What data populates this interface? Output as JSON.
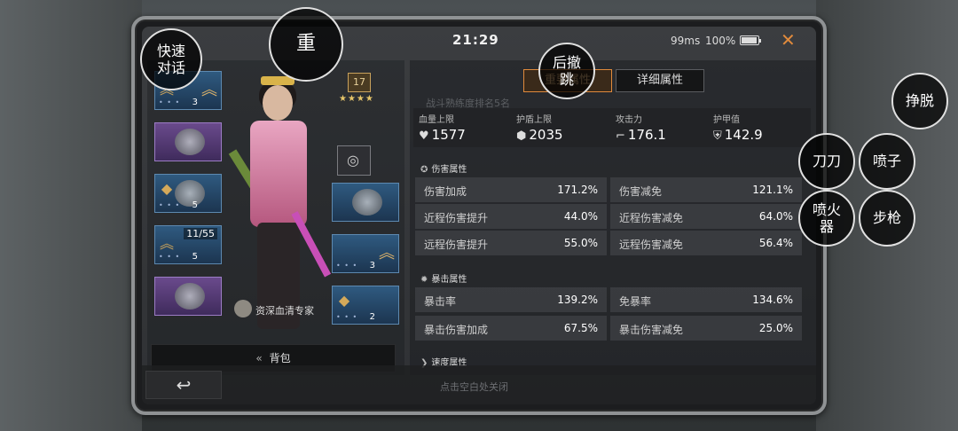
{
  "status": {
    "time": "21:29",
    "ping": "99ms",
    "battery": "100%"
  },
  "left_panel": {
    "level": "17",
    "title": "资深血清专家",
    "bag_label": "背包",
    "slots": [
      {
        "count": "3"
      },
      {
        "count": ""
      },
      {
        "count": "5"
      },
      {
        "count": "5",
        "progress": "11/55"
      },
      {
        "count": ""
      },
      {
        "count": "3"
      },
      {
        "count": "2"
      }
    ]
  },
  "tabs": {
    "main": "重要属性",
    "detail": "详细属性"
  },
  "faded_text": "战斗熟练度排名5名",
  "core_stats": [
    {
      "label": "血量上限",
      "value": "1577",
      "icon": "heart-icon"
    },
    {
      "label": "护盾上限",
      "value": "2035",
      "icon": "shield-icon"
    },
    {
      "label": "攻击力",
      "value": "176.1",
      "icon": "gun-icon"
    },
    {
      "label": "护甲值",
      "value": "142.9",
      "icon": "armor-icon"
    }
  ],
  "sections": {
    "damage": {
      "title": "伤害属性",
      "rows": [
        {
          "k1": "伤害加成",
          "v1": "171.2%",
          "k2": "伤害减免",
          "v2": "121.1%"
        },
        {
          "k1": "近程伤害提升",
          "v1": "44.0%",
          "k2": "近程伤害减免",
          "v2": "64.0%"
        },
        {
          "k1": "远程伤害提升",
          "v1": "55.0%",
          "k2": "远程伤害减免",
          "v2": "56.4%"
        }
      ]
    },
    "crit": {
      "title": "暴击属性",
      "rows": [
        {
          "k1": "暴击率",
          "v1": "139.2%",
          "k2": "免暴率",
          "v2": "134.6%"
        },
        {
          "k1": "暴击伤害加成",
          "v1": "67.5%",
          "k2": "暴击伤害减免",
          "v2": "25.0%"
        }
      ]
    },
    "speed": {
      "title": "速度属性"
    }
  },
  "bottom": {
    "close_hint": "点击空白处关闭"
  },
  "overlays": {
    "quick_chat": "快速对话",
    "heavy": "重",
    "back_jump": "后撤跳",
    "break_free": "挣脱",
    "blade": "刀刀",
    "shotgun": "喷子",
    "flamethrower": "喷火器",
    "rifle": "步枪"
  }
}
